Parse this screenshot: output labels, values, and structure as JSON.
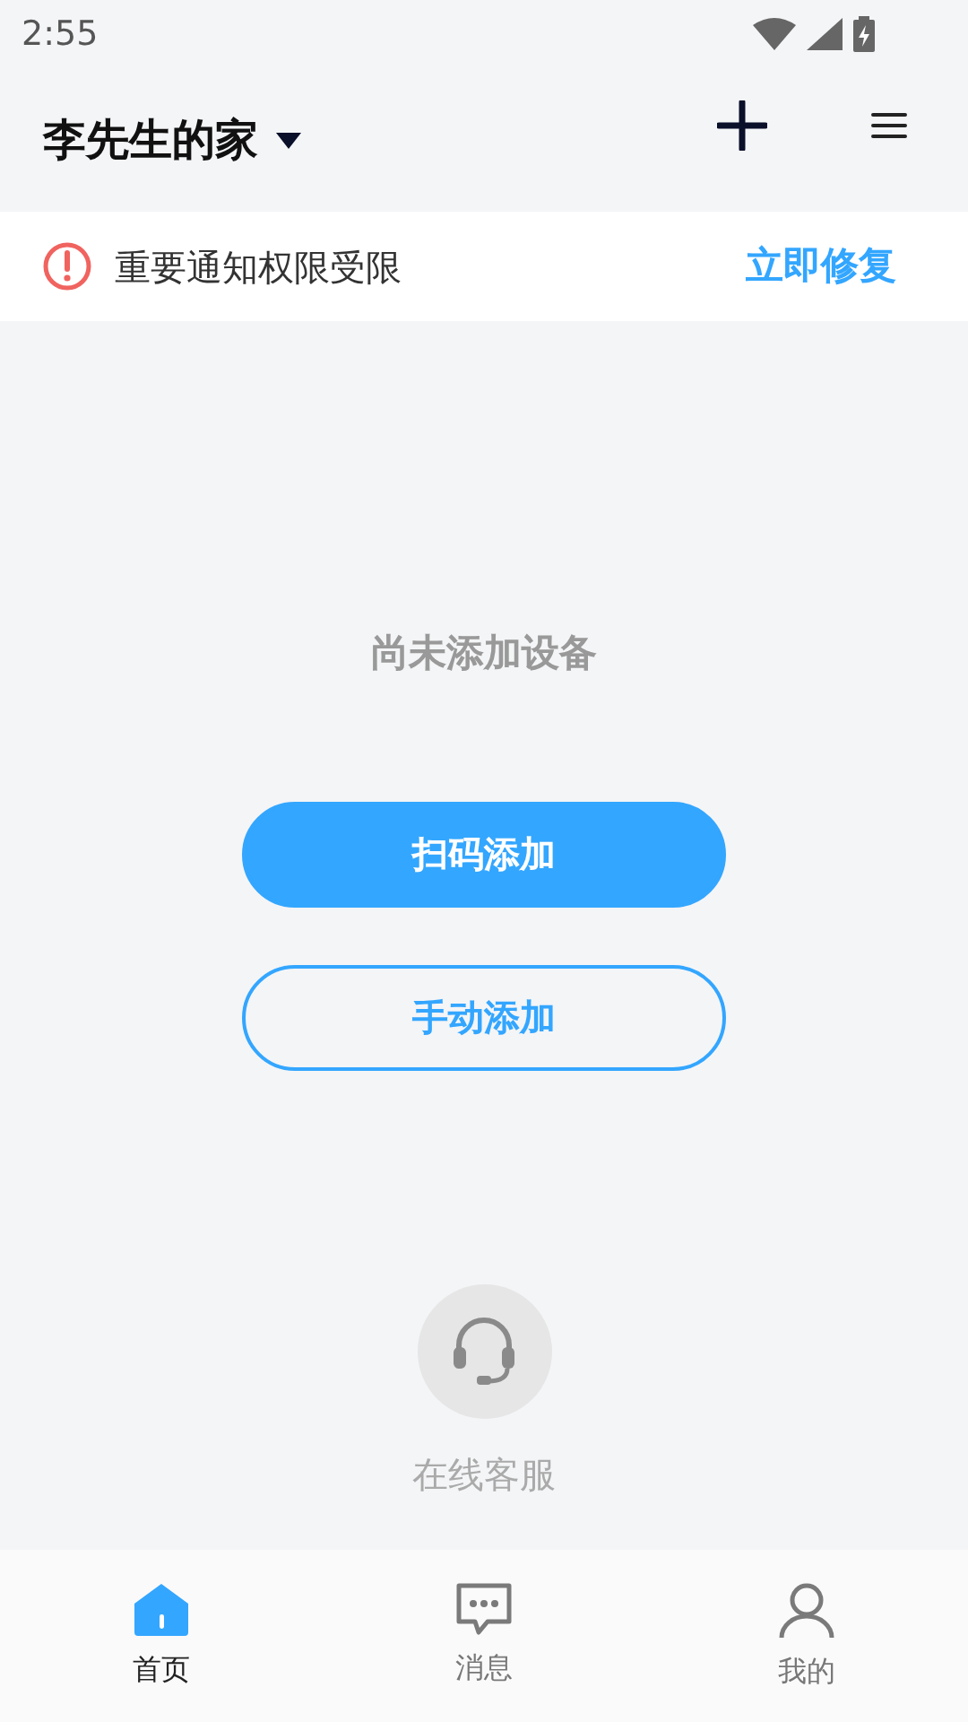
{
  "status_bar": {
    "time": "2:55"
  },
  "header": {
    "title": "李先生的家"
  },
  "notice": {
    "text": "重要通知权限受限",
    "action": "立即修复"
  },
  "empty_state": {
    "message": "尚未添加设备"
  },
  "buttons": [
    {
      "label": "扫码添加",
      "kind": "primary"
    },
    {
      "label": "手动添加",
      "kind": "outline"
    }
  ],
  "support": {
    "label": "在线客服"
  },
  "tabs": [
    {
      "label": "首页",
      "selected": true
    },
    {
      "label": "消息",
      "selected": false
    },
    {
      "label": "我的",
      "selected": false
    }
  ]
}
